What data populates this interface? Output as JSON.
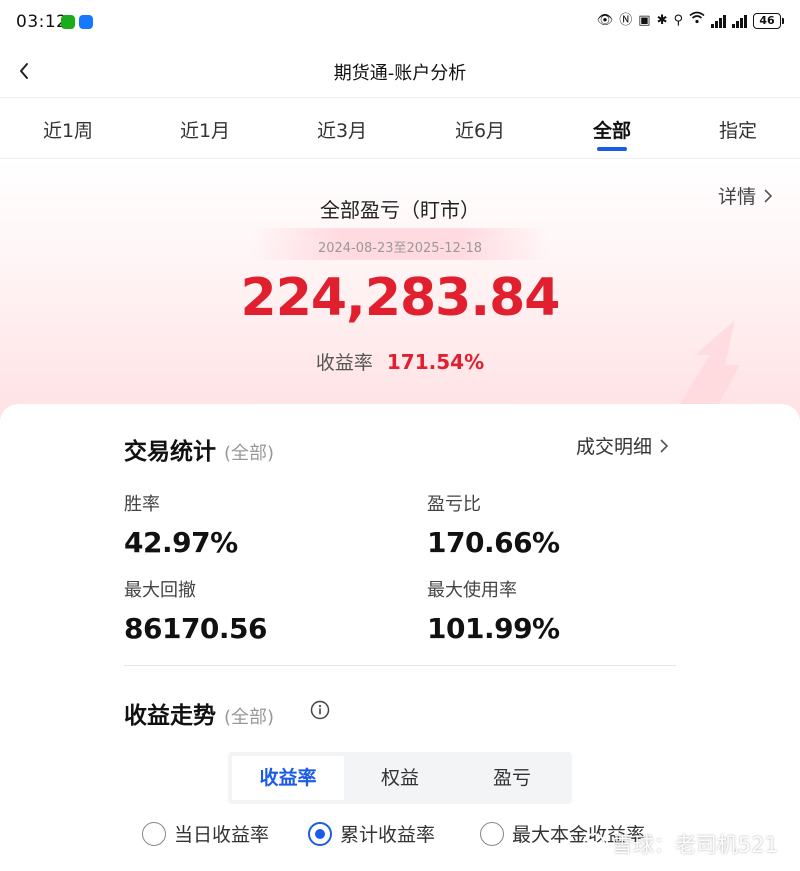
{
  "status_bar": {
    "time": "03:12",
    "battery": "46"
  },
  "header": {
    "title": "期货通-账户分析"
  },
  "period_tabs": [
    {
      "label": "近1周",
      "active": false
    },
    {
      "label": "近1月",
      "active": false
    },
    {
      "label": "近3月",
      "active": false
    },
    {
      "label": "近6月",
      "active": false
    },
    {
      "label": "全部",
      "active": true
    },
    {
      "label": "指定",
      "active": false
    }
  ],
  "summary": {
    "detail_link": "详情",
    "title": "全部盈亏（盯市）",
    "date_range": "2024-08-23至2025-12-18",
    "total_pnl": "224,283.84",
    "return_label": "收益率",
    "return_value": "171.54%"
  },
  "trade_stats": {
    "title": "交易统计",
    "scope": "(全部)",
    "detail_link": "成交明细",
    "items": [
      {
        "label": "胜率",
        "value": "42.97%"
      },
      {
        "label": "盈亏比",
        "value": "170.66%"
      },
      {
        "label": "最大回撤",
        "value": "86170.56"
      },
      {
        "label": "最大使用率",
        "value": "101.99%"
      }
    ]
  },
  "trend": {
    "title": "收益走势",
    "scope": "(全部)",
    "segments": [
      {
        "label": "收益率",
        "active": true
      },
      {
        "label": "权益",
        "active": false
      },
      {
        "label": "盈亏",
        "active": false
      }
    ],
    "radios": [
      {
        "label": "当日收益率",
        "checked": false
      },
      {
        "label": "累计收益率",
        "checked": true
      },
      {
        "label": "最大本金收益率",
        "checked": false
      }
    ]
  },
  "watermark": "雪球：老司机521",
  "colors": {
    "accent_blue": "#1a5ce6",
    "profit_red": "#e0202e"
  }
}
